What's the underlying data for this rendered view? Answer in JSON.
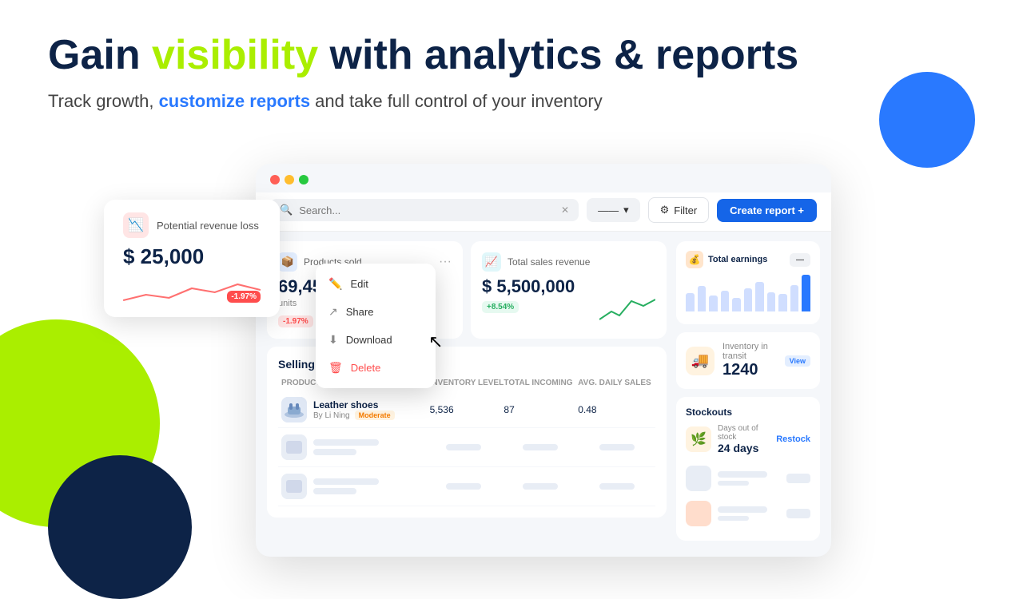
{
  "hero": {
    "title_start": "Gain ",
    "title_highlight": "visibility",
    "title_end": " with analytics & reports",
    "subtitle_start": "Track growth, ",
    "subtitle_bold": "customize reports",
    "subtitle_end": " and take full control of your inventory"
  },
  "revenue_card": {
    "label": "Potential revenue loss",
    "amount": "$ 25,000",
    "badge": "-1.97%"
  },
  "toolbar": {
    "search_placeholder": "Search...",
    "dropdown_label": "——",
    "filter_label": "Filter",
    "create_report_label": "Create report +"
  },
  "metrics": {
    "products_sold": {
      "title": "Products sold",
      "value": "69,453",
      "unit": "units",
      "badge": "-1.97%",
      "badge_type": "red"
    },
    "total_sales": {
      "title": "Total sales revenue",
      "value": "$ 5,500,000",
      "badge": "+8.54%",
      "badge_type": "green"
    }
  },
  "selling_fast": {
    "title": "Selling fast",
    "columns": [
      "Product",
      "Inventory level",
      "Total incoming",
      "Avg. daily sales"
    ],
    "rows": [
      {
        "name": "Leather shoes",
        "brand": "By Li Ning",
        "badge": "Moderate",
        "inventory": "5,536",
        "incoming": "87",
        "daily": "0.48"
      }
    ]
  },
  "right_panel": {
    "earnings": {
      "title": "Total earnings",
      "ctrl_label": "—",
      "bars": [
        40,
        55,
        35,
        45,
        30,
        50,
        65,
        42,
        38,
        58,
        80
      ]
    },
    "transit": {
      "label": "Inventory in transit",
      "value": "1240",
      "badge": "View"
    },
    "stockouts": {
      "title": "Stockouts",
      "days_label": "Days out of stock",
      "days_value": "24 days",
      "restock_label": "Restock"
    }
  },
  "context_menu": {
    "items": [
      {
        "label": "Edit",
        "icon": "✏️"
      },
      {
        "label": "Share",
        "icon": "↗️"
      },
      {
        "label": "Download",
        "icon": "⬇️"
      },
      {
        "label": "Delete",
        "icon": "🗑️"
      }
    ]
  }
}
